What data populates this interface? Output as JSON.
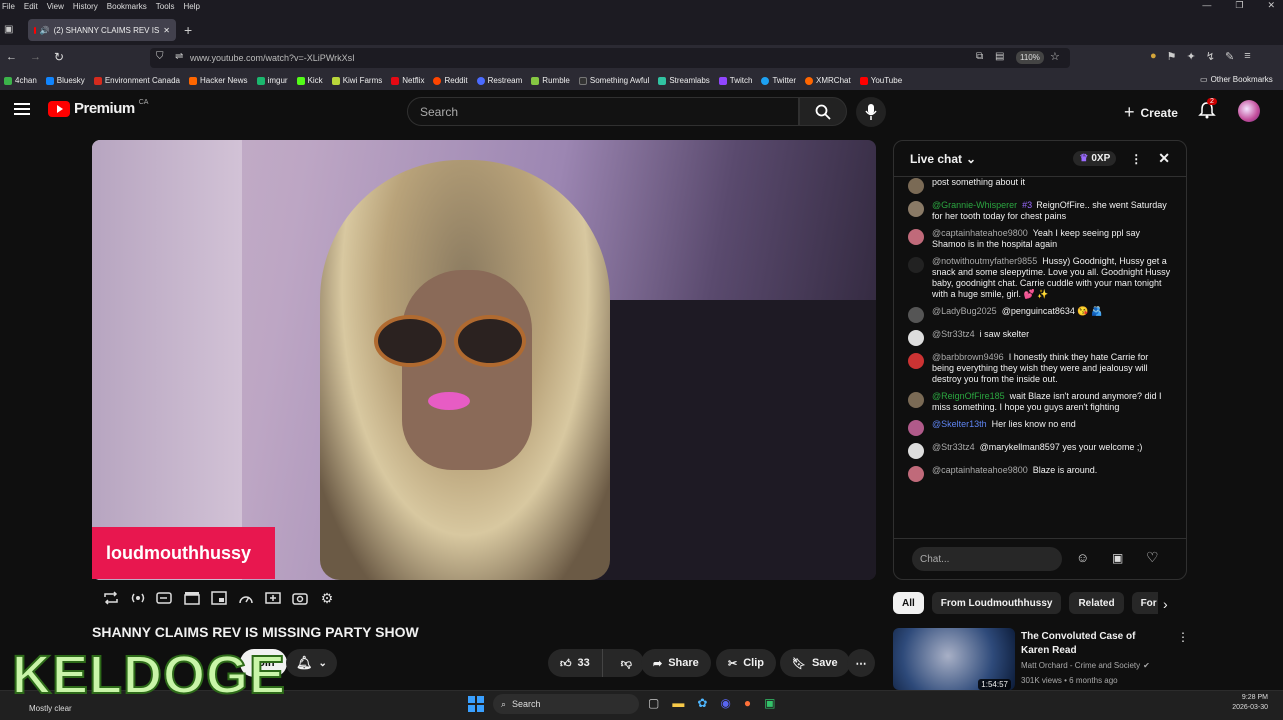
{
  "browser": {
    "menu": [
      "File",
      "Edit",
      "View",
      "History",
      "Bookmarks",
      "Tools",
      "Help"
    ],
    "tab_title": "(2) SHANNY CLAIMS REV IS",
    "url": "www.youtube.com/watch?v=-XLiPWrkXsI",
    "zoom": "110%",
    "bookmarks": [
      {
        "label": "4chan",
        "color": "#3bb34a"
      },
      {
        "label": "Bluesky",
        "color": "#1185fe"
      },
      {
        "label": "Environment Canada",
        "color": "#d52b1e"
      },
      {
        "label": "Hacker News",
        "color": "#ff6600"
      },
      {
        "label": "imgur",
        "color": "#1bb76e"
      },
      {
        "label": "Kick",
        "color": "#53fc18"
      },
      {
        "label": "Kiwi Farms",
        "color": "#b9d63a"
      },
      {
        "label": "Netflix",
        "color": "#e50914"
      },
      {
        "label": "Reddit",
        "color": "#ff4500"
      },
      {
        "label": "Restream",
        "color": "#4b6bff"
      },
      {
        "label": "Rumble",
        "color": "#85c742"
      },
      {
        "label": "Something Awful",
        "color": "#333333"
      },
      {
        "label": "Streamlabs",
        "color": "#31c3a2"
      },
      {
        "label": "Twitch",
        "color": "#9146ff"
      },
      {
        "label": "Twitter",
        "color": "#1da1f2"
      },
      {
        "label": "XMRChat",
        "color": "#ff6600"
      },
      {
        "label": "YouTube",
        "color": "#ff0000"
      }
    ],
    "other_bookmarks": "Other Bookmarks"
  },
  "youtube": {
    "logo": "Premium",
    "region": "CA",
    "search_placeholder": "Search",
    "create": "Create",
    "notif_count": "2",
    "channel_overlay": "loudmouthhussy",
    "video_title": "SHANNY CLAIMS REV IS MISSING PARTY SHOW",
    "join": "Join",
    "likes": "33",
    "share": "Share",
    "clip": "Clip",
    "save": "Save"
  },
  "chat": {
    "title": "Live chat",
    "xp": "0XP",
    "placeholder": "Chat...",
    "messages": [
      {
        "author": "",
        "text": "post something about it",
        "color": "#7a6a55",
        "cls": ""
      },
      {
        "author": "@Grannie-Whisperer",
        "badge": "#3",
        "text": "ReignOfFire.. she went Saturday for her tooth today for chest pains",
        "color": "#8a7a66",
        "cls": "g"
      },
      {
        "author": "@captainhateahoe9800",
        "text": "Yeah I keep seeing ppl say Shamoo is in the hospital again",
        "color": "#c06a7a",
        "cls": ""
      },
      {
        "author": "@notwithoutmyfather9855",
        "text": "Hussy) Goodnight, Hussy get a snack and some sleepytime. Love you all. Goodnight Hussy baby, goodnight chat. Carrie cuddle with your man tonight with a huge smile, girl. 💕 ✨",
        "color": "#222",
        "cls": ""
      },
      {
        "author": "@LadyBug2025",
        "text": "@penguincat8634 😘 🫂",
        "color": "#555",
        "cls": ""
      },
      {
        "author": "@Str33tz4",
        "text": "i saw skelter",
        "color": "#ddd",
        "cls": ""
      },
      {
        "author": "@barbbrown9496",
        "text": "I honestly think they hate Carrie for being everything they wish they were and jealousy will destroy you from the inside out.",
        "color": "#c33",
        "cls": ""
      },
      {
        "author": "@ReignOfFire185",
        "text": "wait Blaze isn't around anymore? did I miss something. I hope you guys aren't fighting",
        "color": "#7a6a55",
        "cls": "g"
      },
      {
        "author": "@Skelter13th",
        "text": "Her lies know no end",
        "color": "#b05a8a",
        "cls": "b"
      },
      {
        "author": "@Str33tz4",
        "text": "@marykellman8597 yes your welcome ;)",
        "color": "#ddd",
        "cls": ""
      },
      {
        "author": "@captainhateahoe9800",
        "text": "Blaze is around.",
        "color": "#c06a7a",
        "cls": ""
      }
    ]
  },
  "chips": [
    "All",
    "From Loudmouthhussy",
    "Related",
    "For y"
  ],
  "recommendation": {
    "title": "The Convoluted Case of Karen Read",
    "channel": "Matt Orchard - Crime and Society",
    "meta": "301K views • 6 months ago",
    "duration": "1:54:57"
  },
  "overlay_text": "KELDOGE",
  "taskbar": {
    "weather": "Mostly clear",
    "search": "Search",
    "time": "9:28 PM",
    "date": "2026-03-30"
  }
}
